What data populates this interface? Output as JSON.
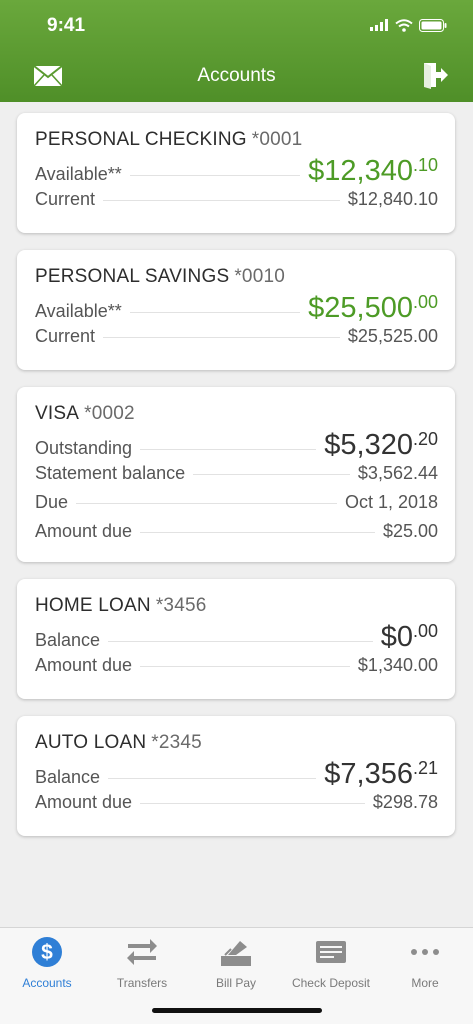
{
  "status": {
    "time": "9:41"
  },
  "nav": {
    "title": "Accounts"
  },
  "accounts": [
    {
      "name": "PERSONAL CHECKING",
      "number": "*0001",
      "rows": [
        {
          "label": "Available**",
          "whole": "$12,340",
          "cents": ".10"
        },
        {
          "label": "Current",
          "value": "$12,840.10"
        }
      ]
    },
    {
      "name": "PERSONAL SAVINGS",
      "number": "*0010",
      "rows": [
        {
          "label": "Available**",
          "whole": "$25,500",
          "cents": ".00"
        },
        {
          "label": "Current",
          "value": "$25,525.00"
        }
      ]
    },
    {
      "name": "VISA",
      "number": "*0002",
      "rows": [
        {
          "label": "Outstanding",
          "whole": "$5,320",
          "cents": ".20"
        },
        {
          "label": "Statement balance",
          "value": "$3,562.44"
        },
        {
          "label": "Due",
          "value": "Oct 1, 2018"
        },
        {
          "label": "Amount due",
          "value": "$25.00"
        }
      ]
    },
    {
      "name": "HOME LOAN",
      "number": "*3456",
      "rows": [
        {
          "label": "Balance",
          "whole": "$0",
          "cents": ".00"
        },
        {
          "label": "Amount due",
          "value": "$1,340.00"
        }
      ]
    },
    {
      "name": "AUTO LOAN",
      "number": "*2345",
      "rows": [
        {
          "label": "Balance",
          "whole": "$7,356",
          "cents": ".21"
        },
        {
          "label": "Amount due",
          "value": "$298.78"
        }
      ]
    }
  ],
  "tabs": [
    {
      "label": "Accounts",
      "icon": "dollar-circle-icon"
    },
    {
      "label": "Transfers",
      "icon": "transfer-arrows-icon"
    },
    {
      "label": "Bill Pay",
      "icon": "bill-pay-icon"
    },
    {
      "label": "Check Deposit",
      "icon": "check-deposit-icon"
    },
    {
      "label": "More",
      "icon": "more-dots-icon"
    }
  ],
  "colors": {
    "header_green": "#5a9a30",
    "positive_green": "#4d9b26",
    "active_tab": "#2f7fd6"
  }
}
